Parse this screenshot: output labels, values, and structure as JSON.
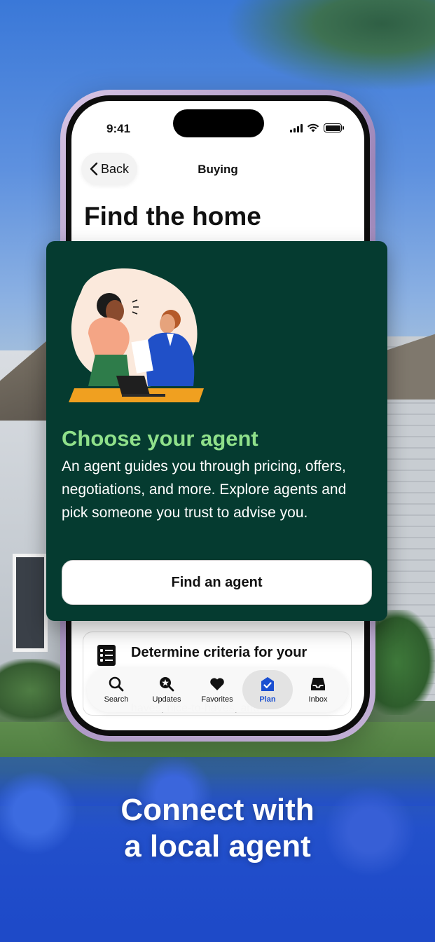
{
  "status_bar": {
    "time": "9:41"
  },
  "nav": {
    "back_label": "Back",
    "title": "Buying"
  },
  "page": {
    "heading": "Find the home"
  },
  "agent_card": {
    "title": "Choose your agent",
    "body": "An agent guides you through pricing, offers, negotiations, and more. Explore agents and pick someone you trust to advise you.",
    "button_label": "Find an agent",
    "title_color": "#8fe08a",
    "background_color": "#053b30"
  },
  "task_card": {
    "title": "Determine criteria for your",
    "faded_text": "haves, nice-to-haves, and"
  },
  "tab_bar": {
    "tabs": [
      {
        "label": "Search",
        "icon": "search-icon"
      },
      {
        "label": "Updates",
        "icon": "updates-icon"
      },
      {
        "label": "Favorites",
        "icon": "heart-icon"
      },
      {
        "label": "Plan",
        "icon": "plan-icon",
        "active": true
      },
      {
        "label": "Inbox",
        "icon": "inbox-icon"
      }
    ],
    "active_color": "#1a4fd1"
  },
  "tagline": {
    "line1": "Connect with",
    "line2": "a local agent"
  }
}
